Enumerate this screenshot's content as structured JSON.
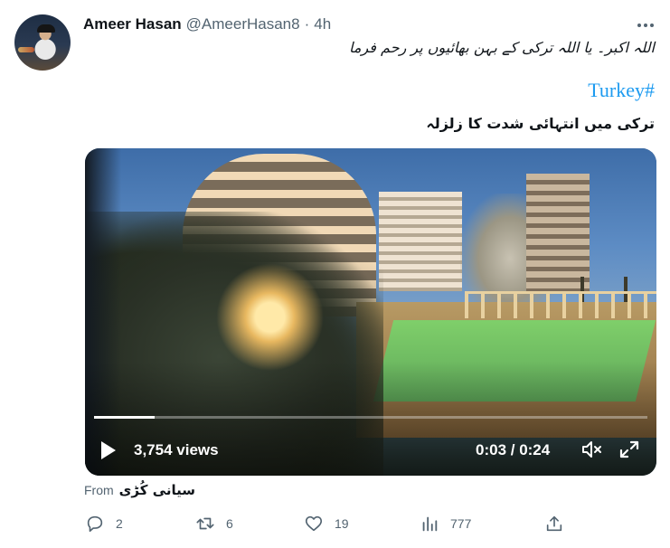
{
  "tweet": {
    "author_name": "Ameer Hasan",
    "author_handle": "@AmeerHasan8",
    "separator": "·",
    "timestamp": "4h",
    "more_icon": "ellipsis-icon",
    "text_line1": "اللہ اکبر۔ یا اللہ ترکی کے بہن بھائیوں پر رحم فرما",
    "hashtag": "Turkey#",
    "text_line2": "ترکی میں انتہائی شدت کا زلزلہ"
  },
  "video": {
    "views": "3,754 views",
    "duration": "0:03 / 0:24",
    "progress": 0.11,
    "play_icon": "play-icon",
    "mute_icon": "mute-icon",
    "fullscreen_icon": "fullscreen-icon"
  },
  "source": {
    "from_label": "From",
    "source_name": "سیانی کُڑی"
  },
  "actions": {
    "replies": "2",
    "retweets": "6",
    "likes": "19",
    "views": "777",
    "share_icon": "share-icon"
  },
  "colors": {
    "accent": "#1d9bf0",
    "secondary_text": "#536471",
    "primary_text": "#0f1419"
  }
}
